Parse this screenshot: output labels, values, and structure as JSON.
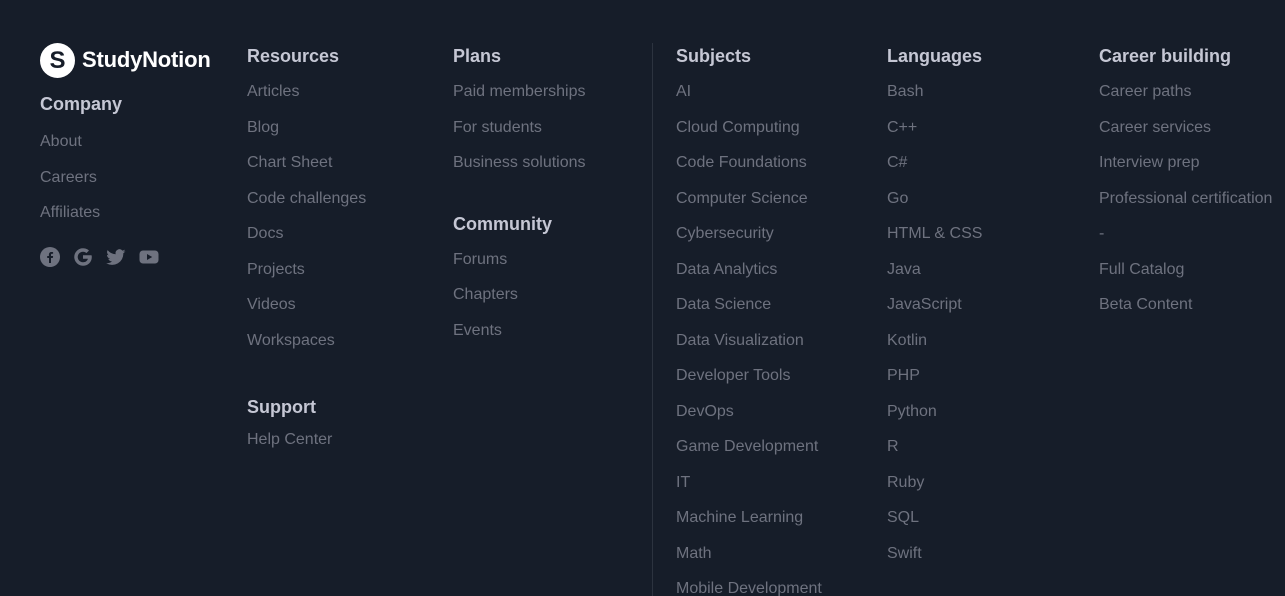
{
  "brand": {
    "name": "StudyNotion",
    "mark": "S"
  },
  "company": {
    "heading": "Company",
    "items": [
      "About",
      "Careers",
      "Affiliates"
    ]
  },
  "socials": [
    "facebook-icon",
    "google-icon",
    "twitter-icon",
    "youtube-icon"
  ],
  "resources": {
    "heading": "Resources",
    "items": [
      "Articles",
      "Blog",
      "Chart Sheet",
      "Code challenges",
      "Docs",
      "Projects",
      "Videos",
      "Workspaces"
    ]
  },
  "support": {
    "heading": "Support",
    "items": [
      "Help Center"
    ]
  },
  "plans": {
    "heading": "Plans",
    "items": [
      "Paid memberships",
      "For students",
      "Business solutions"
    ]
  },
  "community": {
    "heading": "Community",
    "items": [
      "Forums",
      "Chapters",
      "Events"
    ]
  },
  "subjects": {
    "heading": "Subjects",
    "items": [
      "AI",
      "Cloud Computing",
      "Code Foundations",
      "Computer Science",
      "Cybersecurity",
      "Data Analytics",
      "Data Science",
      "Data Visualization",
      "Developer Tools",
      "DevOps",
      "Game Development",
      "IT",
      "Machine Learning",
      "Math",
      "Mobile Development"
    ]
  },
  "languages": {
    "heading": "Languages",
    "items": [
      "Bash",
      "C++",
      "C#",
      "Go",
      "HTML & CSS",
      "Java",
      "JavaScript",
      "Kotlin",
      "PHP",
      "Python",
      "R",
      "Ruby",
      "SQL",
      "Swift"
    ]
  },
  "career": {
    "heading": "Career building",
    "items": [
      "Career paths",
      "Career services",
      "Interview prep",
      "Professional certification",
      "-",
      "Full Catalog",
      "Beta Content"
    ]
  },
  "colors": {
    "background": "#161d29",
    "heading": "#c5c7d4",
    "link": "#6e727f",
    "divider": "#2c333f"
  }
}
